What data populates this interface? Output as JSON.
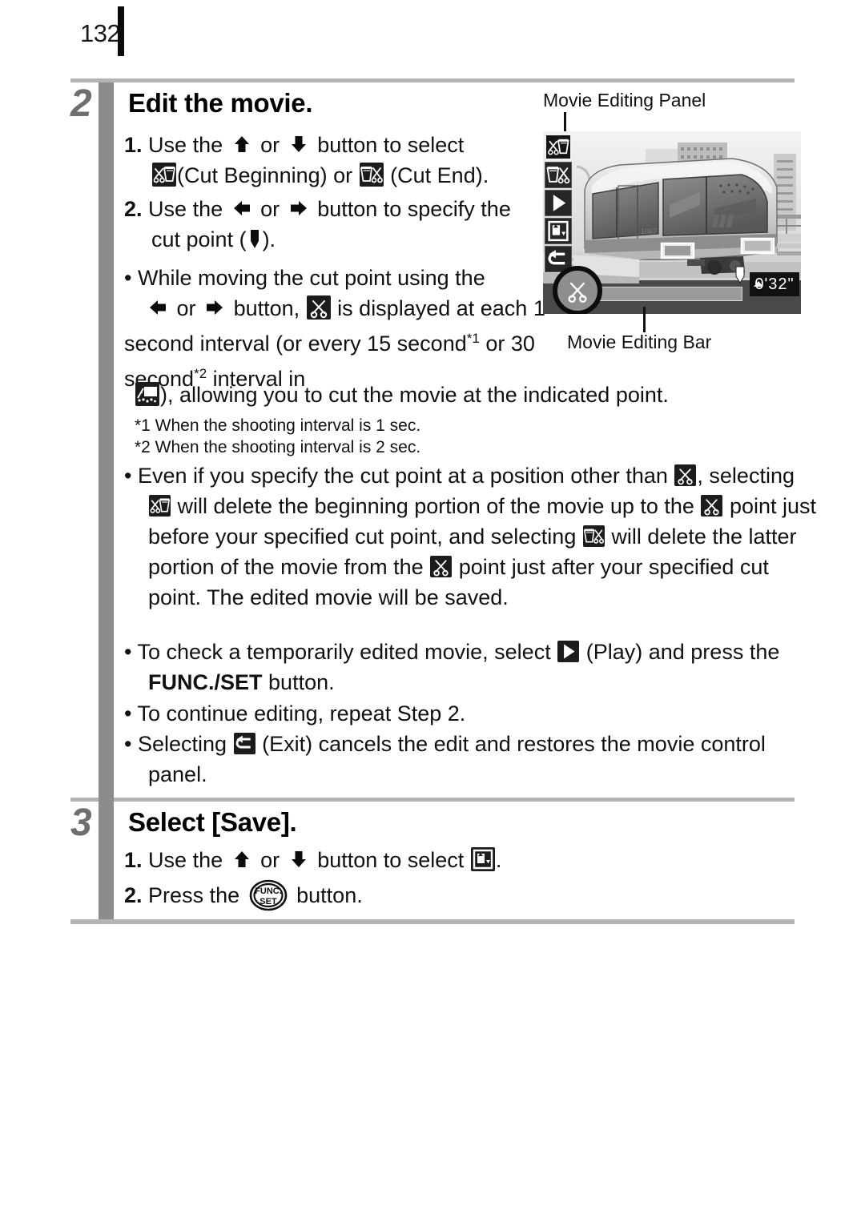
{
  "page": {
    "number": "132"
  },
  "steps": [
    {
      "number": "2",
      "title": "Edit the movie.",
      "items": [
        {
          "label": "1.",
          "text_a": "Use the",
          "text_b": "or",
          "text_c": "button to select",
          "text_d": "(Cut Beginning) or",
          "text_e": "(Cut End)."
        },
        {
          "label": "2.",
          "text_a": "Use the",
          "text_b": "or",
          "text_c": "button to specify the",
          "text_d": "cut point (",
          "text_e": ")."
        }
      ],
      "bullets": [
        {
          "part1": "While moving the cut point using the",
          "part2": "or",
          "part3": "button,",
          "part4": "is displayed at each 1 second interval (or every 15 second",
          "sup1": "*1",
          "part5": "or 30 second",
          "sup2": "*2",
          "part6": "interval  in",
          "part7": "), allowing you to cut the movie at the indicated point."
        },
        {
          "part1": "Even if you specify the cut point at a position other than",
          "part2": ", selecting",
          "part3": "will delete the beginning portion of the movie up to the",
          "part4": "point just before your specified cut point, and selecting",
          "part5": "will delete the latter portion of the movie from the",
          "part6": "point just after your specified cut point. The edited movie will be saved."
        },
        {
          "part1": "To check a temporarily edited movie, select",
          "part2": "(Play) and press the",
          "bold": "FUNC./SET",
          "part3": "button."
        },
        {
          "part1": "To continue editing, repeat Step 2."
        },
        {
          "part1": "Selecting",
          "part2": "(Exit) cancels the edit and restores the movie control panel."
        }
      ],
      "footnotes": [
        "*1 When the shooting interval is 1 sec.",
        "*2 When the shooting interval is 2 sec."
      ]
    },
    {
      "number": "3",
      "title": "Select [Save].",
      "items": [
        {
          "label": "1.",
          "text_a": "Use the",
          "text_b": "or",
          "text_c": "button to select",
          "text_d": "."
        },
        {
          "label": "2.",
          "text_a": "Press the",
          "text_b": "button."
        }
      ]
    }
  ],
  "figure": {
    "panel_label": "Movie Editing Panel",
    "bar_label": "Movie Editing Bar",
    "time_display": "0'32\"",
    "panel_buttons": [
      "cut-beginning-icon",
      "cut-end-icon",
      "play-icon",
      "save-icon",
      "exit-icon"
    ]
  },
  "icons": {
    "cut_beginning": "cut-beginning-icon",
    "cut_end": "cut-end-icon",
    "scissors": "scissors-icon",
    "play": "play-icon",
    "save": "save-icon",
    "exit": "exit-icon",
    "timelapse": "timelapse-frame-icon",
    "up": "up-arrow-icon",
    "down": "down-arrow-icon",
    "left": "left-arrow-icon",
    "right": "right-arrow-icon",
    "cut_point_marker": "cut-point-marker-icon",
    "func_set": "func-set-button-icon"
  },
  "colors": {
    "rule": "#b4b4b4",
    "spine": "#8c8c8c",
    "step_number": "#6e6e6e",
    "icon_bg": "#1c1c1c",
    "text": "#111111"
  }
}
